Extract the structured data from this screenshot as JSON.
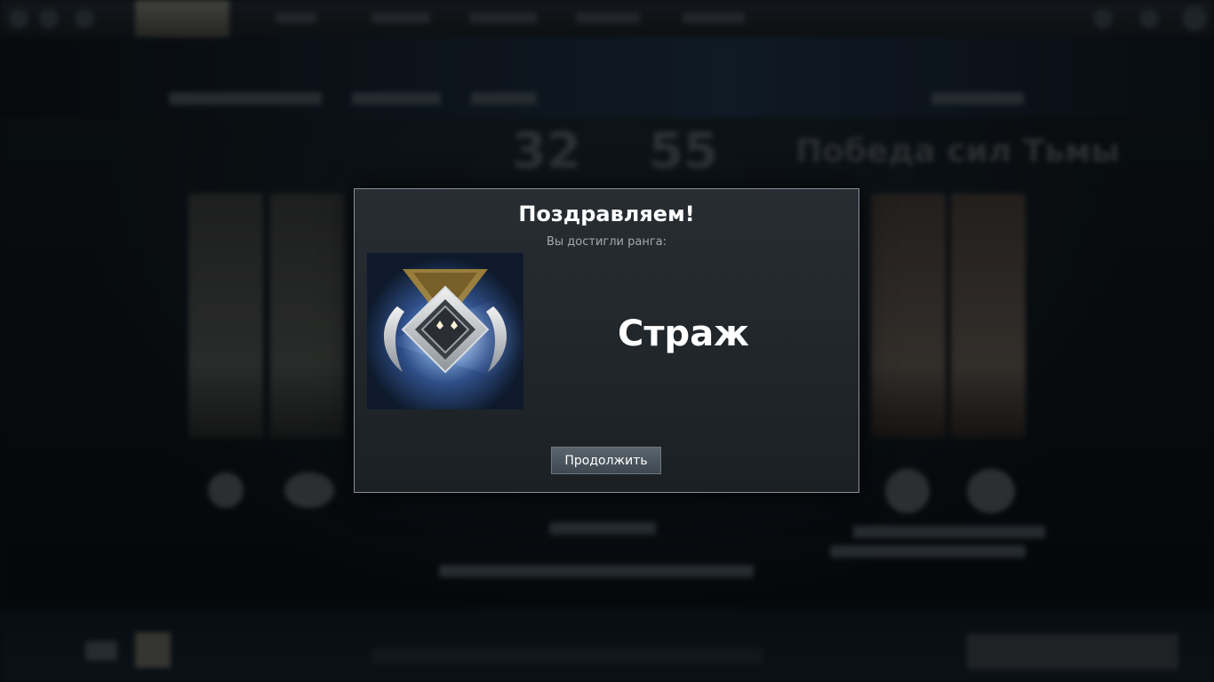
{
  "modal": {
    "title": "Поздравляем!",
    "subtitle": "Вы достигли ранга:",
    "rank_name": "Страж",
    "rank_icon": "guardian-rank-medal-icon",
    "continue_label": "Продолжить"
  },
  "background": {
    "score_left": "32",
    "score_right": "55",
    "result_text": "Победа сил Тьмы"
  },
  "colors": {
    "modal_border": "#8a9096",
    "button": "#4c5760",
    "title_text": "#ffffff"
  }
}
